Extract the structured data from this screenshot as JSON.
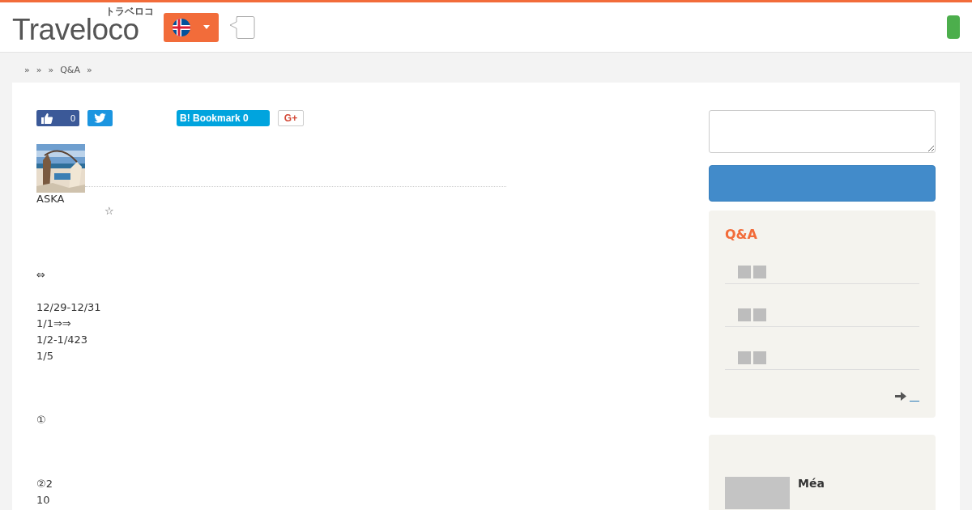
{
  "header": {
    "logo": "Traveloco",
    "logo_kana": "トラベロコ"
  },
  "breadcrumb": [
    "»",
    "»",
    "»",
    "Q&A",
    "»"
  ],
  "share": {
    "like_count": "0",
    "bookmark_label": "B! Bookmark 0",
    "gplus_label": "G+"
  },
  "author": {
    "name": "ASKA",
    "star": "☆"
  },
  "paragraphs": [
    [
      "⇔"
    ],
    [
      "12/29-12/31",
      "1/1⇒⇒",
      "1/2-1/423",
      "1/5"
    ],
    [
      "①"
    ],
    [
      "②2",
      "10"
    ]
  ],
  "sidebar": {
    "qa_title": "Q&A",
    "qa_items": [
      {
        "kind": "glyphs"
      },
      {
        "kind": "glyphs"
      },
      {
        "kind": "glyphs"
      }
    ],
    "next_panel_text": "Méa"
  }
}
